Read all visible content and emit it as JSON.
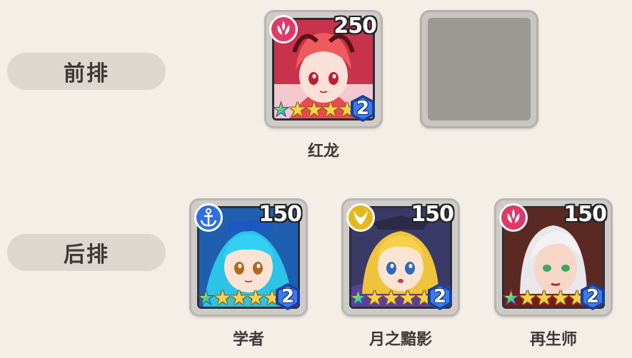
{
  "rows": {
    "front_label": "前排",
    "back_label": "后排"
  },
  "heroes": [
    {
      "name": "红龙",
      "power": "250",
      "level": "2",
      "stars": 5,
      "type_icon": "fire-crest-icon",
      "type_color": "#e0386a"
    },
    {
      "name": "学者",
      "power": "150",
      "level": "2",
      "stars": 5,
      "type_icon": "anchor-icon",
      "type_color": "#2f6fe0"
    },
    {
      "name": "月之黯影",
      "power": "150",
      "level": "2",
      "stars": 5,
      "type_icon": "horns-icon",
      "type_color": "#e2b81c"
    },
    {
      "name": "再生师",
      "power": "150",
      "level": "2",
      "stars": 5,
      "type_icon": "fire-crest-icon",
      "type_color": "#e0386a"
    }
  ],
  "colors": {
    "background": "#f3eee6",
    "label_bg": "#ddd7cf",
    "level_badge": "#2f66d8"
  }
}
